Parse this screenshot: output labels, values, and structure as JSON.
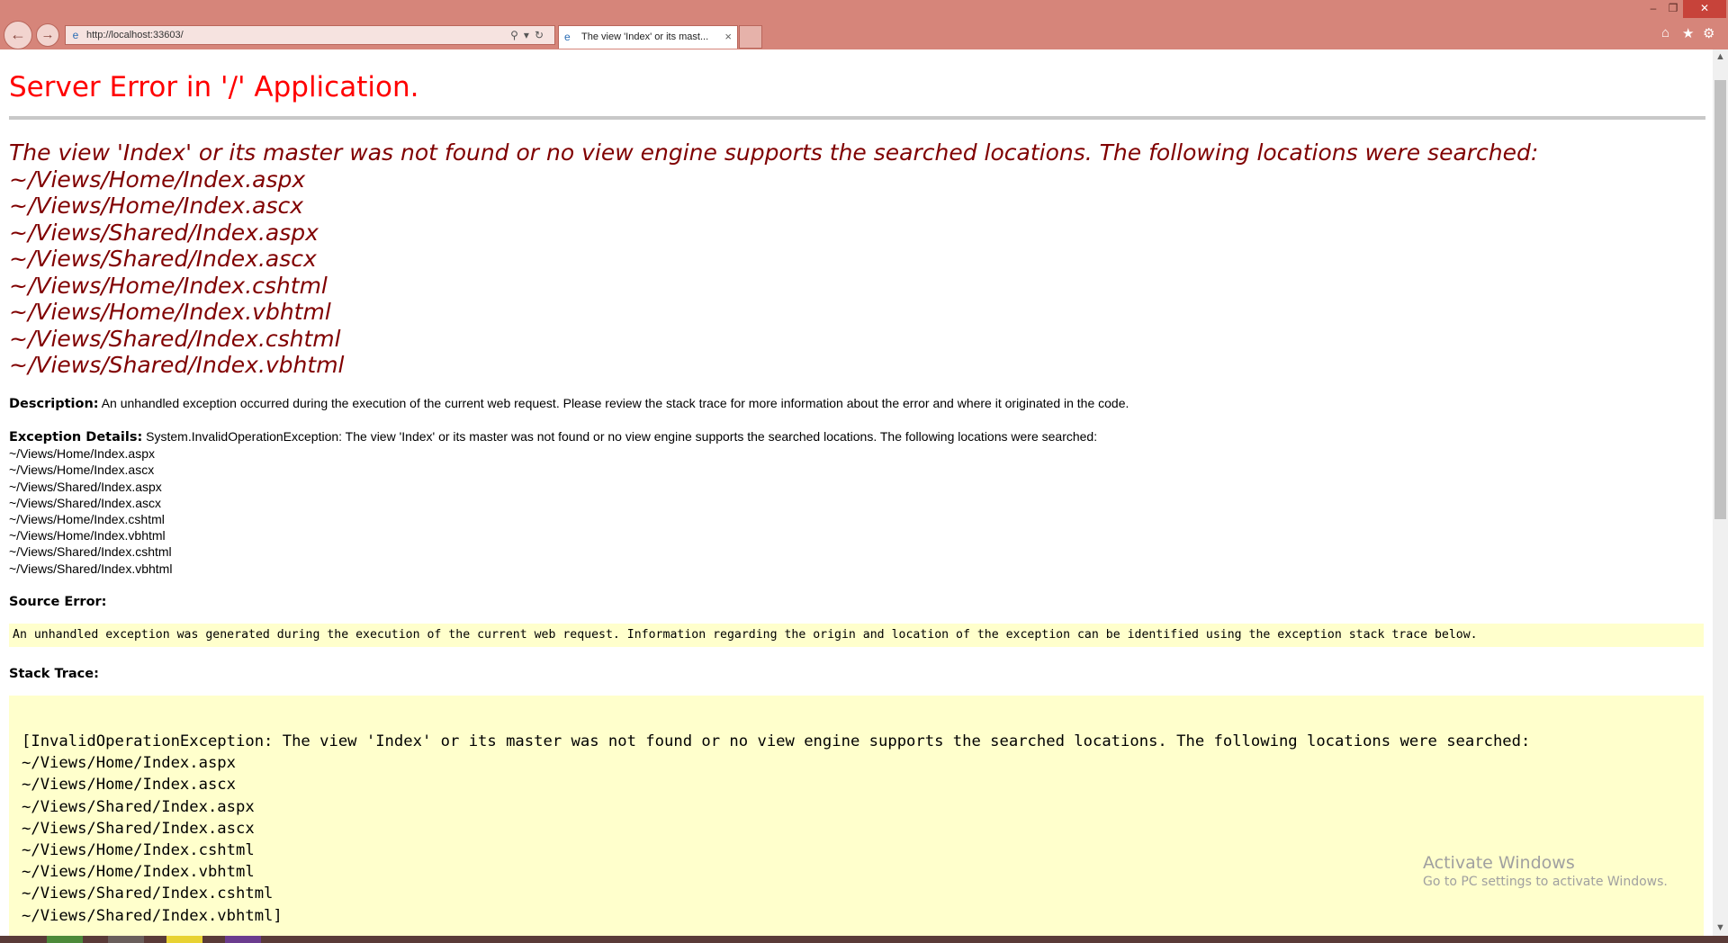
{
  "browser": {
    "url": "http://localhost:33603/",
    "tab_title": "The view 'Index' or its mast...",
    "tab_close": "×",
    "back_icon": "back-arrow-icon",
    "forward_icon": "forward-arrow-icon",
    "colors": {
      "chrome": "#d6857a",
      "close_button": "#c7433a"
    }
  },
  "page": {
    "title": "Server Error in '/' Application.",
    "error_heading_lines": [
      "The view 'Index' or its master was not found or no view engine supports the searched locations. The following locations were searched:",
      "~/Views/Home/Index.aspx",
      "~/Views/Home/Index.ascx",
      "~/Views/Shared/Index.aspx",
      "~/Views/Shared/Index.ascx",
      "~/Views/Home/Index.cshtml",
      "~/Views/Home/Index.vbhtml",
      "~/Views/Shared/Index.cshtml",
      "~/Views/Shared/Index.vbhtml"
    ],
    "description_label": "Description:",
    "description_text": "An unhandled exception occurred during the execution of the current web request. Please review the stack trace for more information about the error and where it originated in the code.",
    "exception_label": "Exception Details:",
    "exception_lines": [
      "System.InvalidOperationException: The view 'Index' or its master was not found or no view engine supports the searched locations. The following locations were searched:",
      "~/Views/Home/Index.aspx",
      "~/Views/Home/Index.ascx",
      "~/Views/Shared/Index.aspx",
      "~/Views/Shared/Index.ascx",
      "~/Views/Home/Index.cshtml",
      "~/Views/Home/Index.vbhtml",
      "~/Views/Shared/Index.cshtml",
      "~/Views/Shared/Index.vbhtml"
    ],
    "source_error_label": "Source Error:",
    "source_error_text": "An unhandled exception was generated during the execution of the current web request. Information regarding the origin and location of the exception can be identified using the exception stack trace below.",
    "stack_trace_label": "Stack Trace:",
    "stack_trace_lines": [
      "[InvalidOperationException: The view 'Index' or its master was not found or no view engine supports the searched locations. The following locations were searched:",
      "~/Views/Home/Index.aspx",
      "~/Views/Home/Index.ascx",
      "~/Views/Shared/Index.aspx",
      "~/Views/Shared/Index.ascx",
      "~/Views/Home/Index.cshtml",
      "~/Views/Home/Index.vbhtml",
      "~/Views/Shared/Index.cshtml",
      "~/Views/Shared/Index.vbhtml]"
    ],
    "colors": {
      "title": "#ff0000",
      "heading": "#800000",
      "code_bg": "#ffffcc"
    }
  },
  "watermark": {
    "title": "Activate Windows",
    "subtitle": "Go to PC settings to activate Windows."
  }
}
